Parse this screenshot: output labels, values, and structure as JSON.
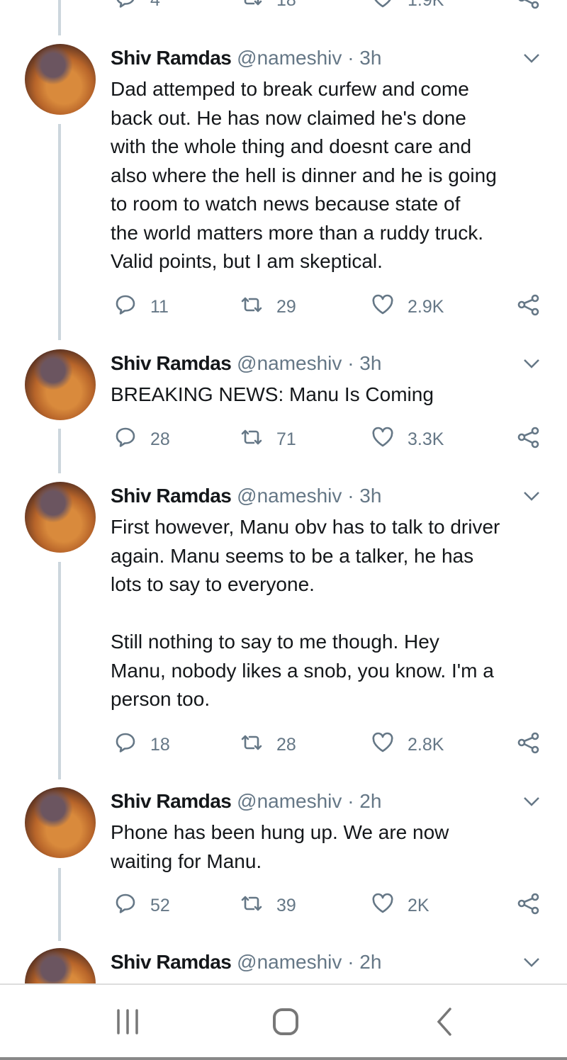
{
  "partial_top_actions": {
    "replies": "4",
    "retweets": "18",
    "likes": "1.9K"
  },
  "tweets": [
    {
      "name": "Shiv Ramdas",
      "handle": "@nameshiv",
      "time": "3h",
      "body": "Dad attemped to break curfew and come\nback out. He has now claimed he's done\nwith the whole thing and doesnt care and\nalso where the hell is dinner and he is going\nto room to watch news because state of\nthe world matters more than a ruddy truck.\nValid points, but I am skeptical.",
      "replies": "11",
      "retweets": "29",
      "likes": "2.9K"
    },
    {
      "name": "Shiv Ramdas",
      "handle": "@nameshiv",
      "time": "3h",
      "body": "BREAKING NEWS: Manu Is Coming",
      "replies": "28",
      "retweets": "71",
      "likes": "3.3K"
    },
    {
      "name": "Shiv Ramdas",
      "handle": "@nameshiv",
      "time": "3h",
      "body": "First however, Manu obv has to talk to driver\nagain. Manu seems to be a talker, he has\nlots to say to everyone.\n\nStill nothing to say to me though. Hey\nManu, nobody likes a snob, you know. I'm a\nperson too.",
      "replies": "18",
      "retweets": "28",
      "likes": "2.8K"
    },
    {
      "name": "Shiv Ramdas",
      "handle": "@nameshiv",
      "time": "2h",
      "body": "Phone has been hung up. We are now\nwaiting for Manu.",
      "replies": "52",
      "retweets": "39",
      "likes": "2K"
    },
    {
      "name": "Shiv Ramdas",
      "handle": "@nameshiv",
      "time": "2h",
      "body": ""
    }
  ],
  "separator": "·",
  "colors": {
    "text": "#14171a",
    "secondary": "#657786",
    "thread": "#ccd6dd"
  },
  "nav": {
    "icons": [
      "recent-apps-icon",
      "home-icon",
      "back-icon"
    ]
  }
}
